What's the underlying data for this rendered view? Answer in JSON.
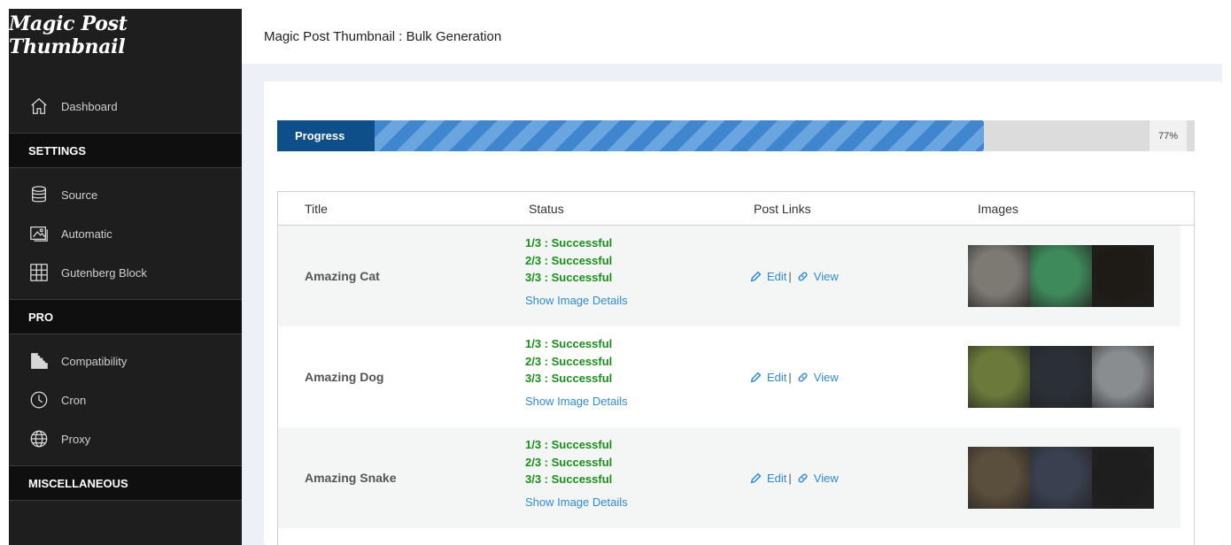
{
  "app": {
    "logo": "Magic Post Thumbnail",
    "page_title": "Magic Post Thumbnail : Bulk Generation"
  },
  "sidebar": {
    "dashboard": {
      "label": "Dashboard",
      "icon": "home-icon"
    },
    "sections": [
      {
        "header": "SETTINGS",
        "items": [
          {
            "label": "Source",
            "icon": "database-icon"
          },
          {
            "label": "Automatic",
            "icon": "images-icon"
          },
          {
            "label": "Gutenberg Block",
            "icon": "grid-icon"
          }
        ]
      },
      {
        "header": "PRO",
        "items": [
          {
            "label": "Compatibility",
            "icon": "puzzle-icon"
          },
          {
            "label": "Cron",
            "icon": "clock-icon"
          },
          {
            "label": "Proxy",
            "icon": "globe-icon"
          }
        ]
      },
      {
        "header": "MISCELLANEOUS",
        "items": []
      }
    ]
  },
  "progress": {
    "label": "Progress",
    "percent_text": "77%",
    "value": 0.77
  },
  "table": {
    "headers": {
      "title": "Title",
      "status": "Status",
      "links": "Post Links",
      "images": "Images"
    },
    "rows": [
      {
        "title": "Amazing Cat",
        "statuses": [
          "1/3 : Successful",
          "2/3 : Successful",
          "3/3 : Successful"
        ],
        "details": "Show Image Details",
        "edit": "Edit",
        "separator": "|",
        "view": "View",
        "image_colors": [
          "#7d7a74",
          "#3e8a5a",
          "#1e1a16"
        ]
      },
      {
        "title": "Amazing Dog",
        "statuses": [
          "1/3 : Successful",
          "2/3 : Successful",
          "3/3 : Successful"
        ],
        "details": "Show Image Details",
        "edit": "Edit",
        "separator": "|",
        "view": "View",
        "image_colors": [
          "#6b7a3a",
          "#2b3038",
          "#8a8d90"
        ]
      },
      {
        "title": "Amazing Snake",
        "statuses": [
          "1/3 : Successful",
          "2/3 : Successful",
          "3/3 : Successful"
        ],
        "details": "Show Image Details",
        "edit": "Edit",
        "separator": "|",
        "view": "View",
        "image_colors": [
          "#5a4e3c",
          "#3a4050",
          "#1e1e1e"
        ]
      }
    ]
  },
  "colors": {
    "accent": "#2f8ad8",
    "success": "#1a8f1a",
    "sidebar_bg": "#1e1e1e",
    "progress_label_bg": "#0e4f8a"
  }
}
